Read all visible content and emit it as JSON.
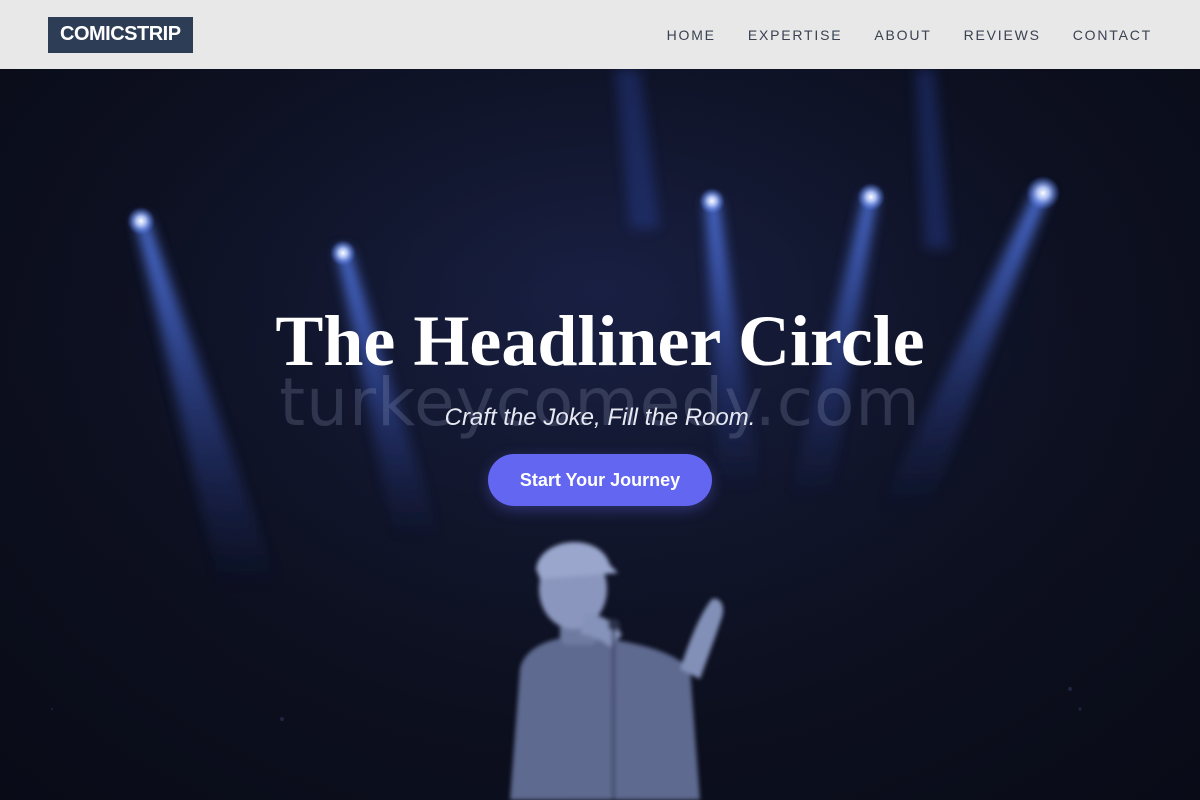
{
  "header": {
    "logo": "COMICSTRIP",
    "nav": [
      {
        "label": "HOME"
      },
      {
        "label": "EXPERTISE"
      },
      {
        "label": "ABOUT"
      },
      {
        "label": "REVIEWS"
      },
      {
        "label": "CONTACT"
      }
    ]
  },
  "hero": {
    "title": "The Headliner Circle",
    "watermark": "turkeycomedy.com",
    "subtitle": "Craft the Joke, Fill the Room.",
    "cta_label": "Start Your Journey"
  },
  "colors": {
    "header_bg": "#e8e8e8",
    "logo_bg": "#2d3d55",
    "accent": "#6366f1",
    "hero_bg": "#0d1020",
    "spotlight": "#4a78ff"
  }
}
